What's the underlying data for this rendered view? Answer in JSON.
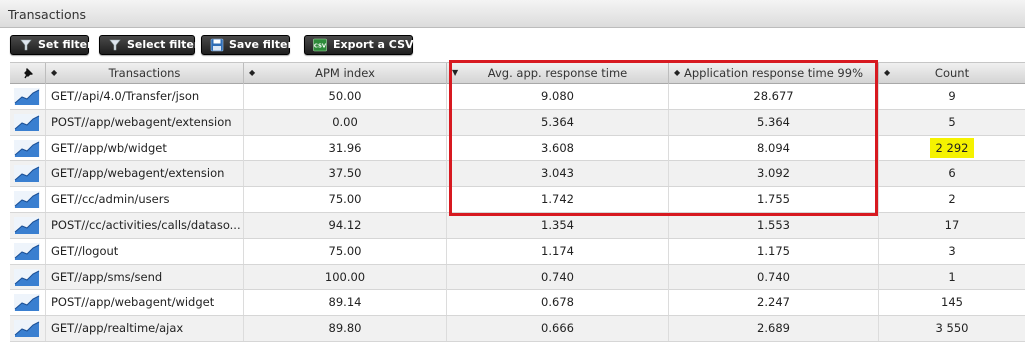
{
  "panel": {
    "title": "Transactions"
  },
  "toolbar": {
    "set_filter": "Set filter",
    "select_filter": "Select filter",
    "save_filter": "Save filter",
    "export_csv": "Export a CSV",
    "csv_icon_text": "CSV"
  },
  "columns": {
    "transactions": "Transactions",
    "apm_index": "APM index",
    "avg_response": "Avg. app. response time",
    "resp_99": "Application response time 99%",
    "count": "Count"
  },
  "rows": [
    {
      "name": "GET//api/4.0/Transfer/json",
      "apm": "50.00",
      "avg": "9.080",
      "p99": "28.677",
      "count": "9"
    },
    {
      "name": "POST//app/webagent/extension",
      "apm": "0.00",
      "avg": "5.364",
      "p99": "5.364",
      "count": "5"
    },
    {
      "name": "GET//app/wb/widget",
      "apm": "31.96",
      "avg": "3.608",
      "p99": "8.094",
      "count": "2 292"
    },
    {
      "name": "GET//app/webagent/extension",
      "apm": "37.50",
      "avg": "3.043",
      "p99": "3.092",
      "count": "6"
    },
    {
      "name": "GET//cc/admin/users",
      "apm": "75.00",
      "avg": "1.742",
      "p99": "1.755",
      "count": "2"
    },
    {
      "name": "POST//cc/activities/calls/dataso...",
      "apm": "94.12",
      "avg": "1.354",
      "p99": "1.553",
      "count": "17"
    },
    {
      "name": "GET//logout",
      "apm": "75.00",
      "avg": "1.174",
      "p99": "1.175",
      "count": "3"
    },
    {
      "name": "GET//app/sms/send",
      "apm": "100.00",
      "avg": "0.740",
      "p99": "0.740",
      "count": "1"
    },
    {
      "name": "POST//app/webagent/widget",
      "apm": "89.14",
      "avg": "0.678",
      "p99": "2.247",
      "count": "145"
    },
    {
      "name": "GET//app/realtime/ajax",
      "apm": "89.80",
      "avg": "0.666",
      "p99": "2.689",
      "count": "3 550"
    }
  ],
  "annotations": {
    "highlight_color": "#f5f200",
    "box_color": "#d71920"
  }
}
